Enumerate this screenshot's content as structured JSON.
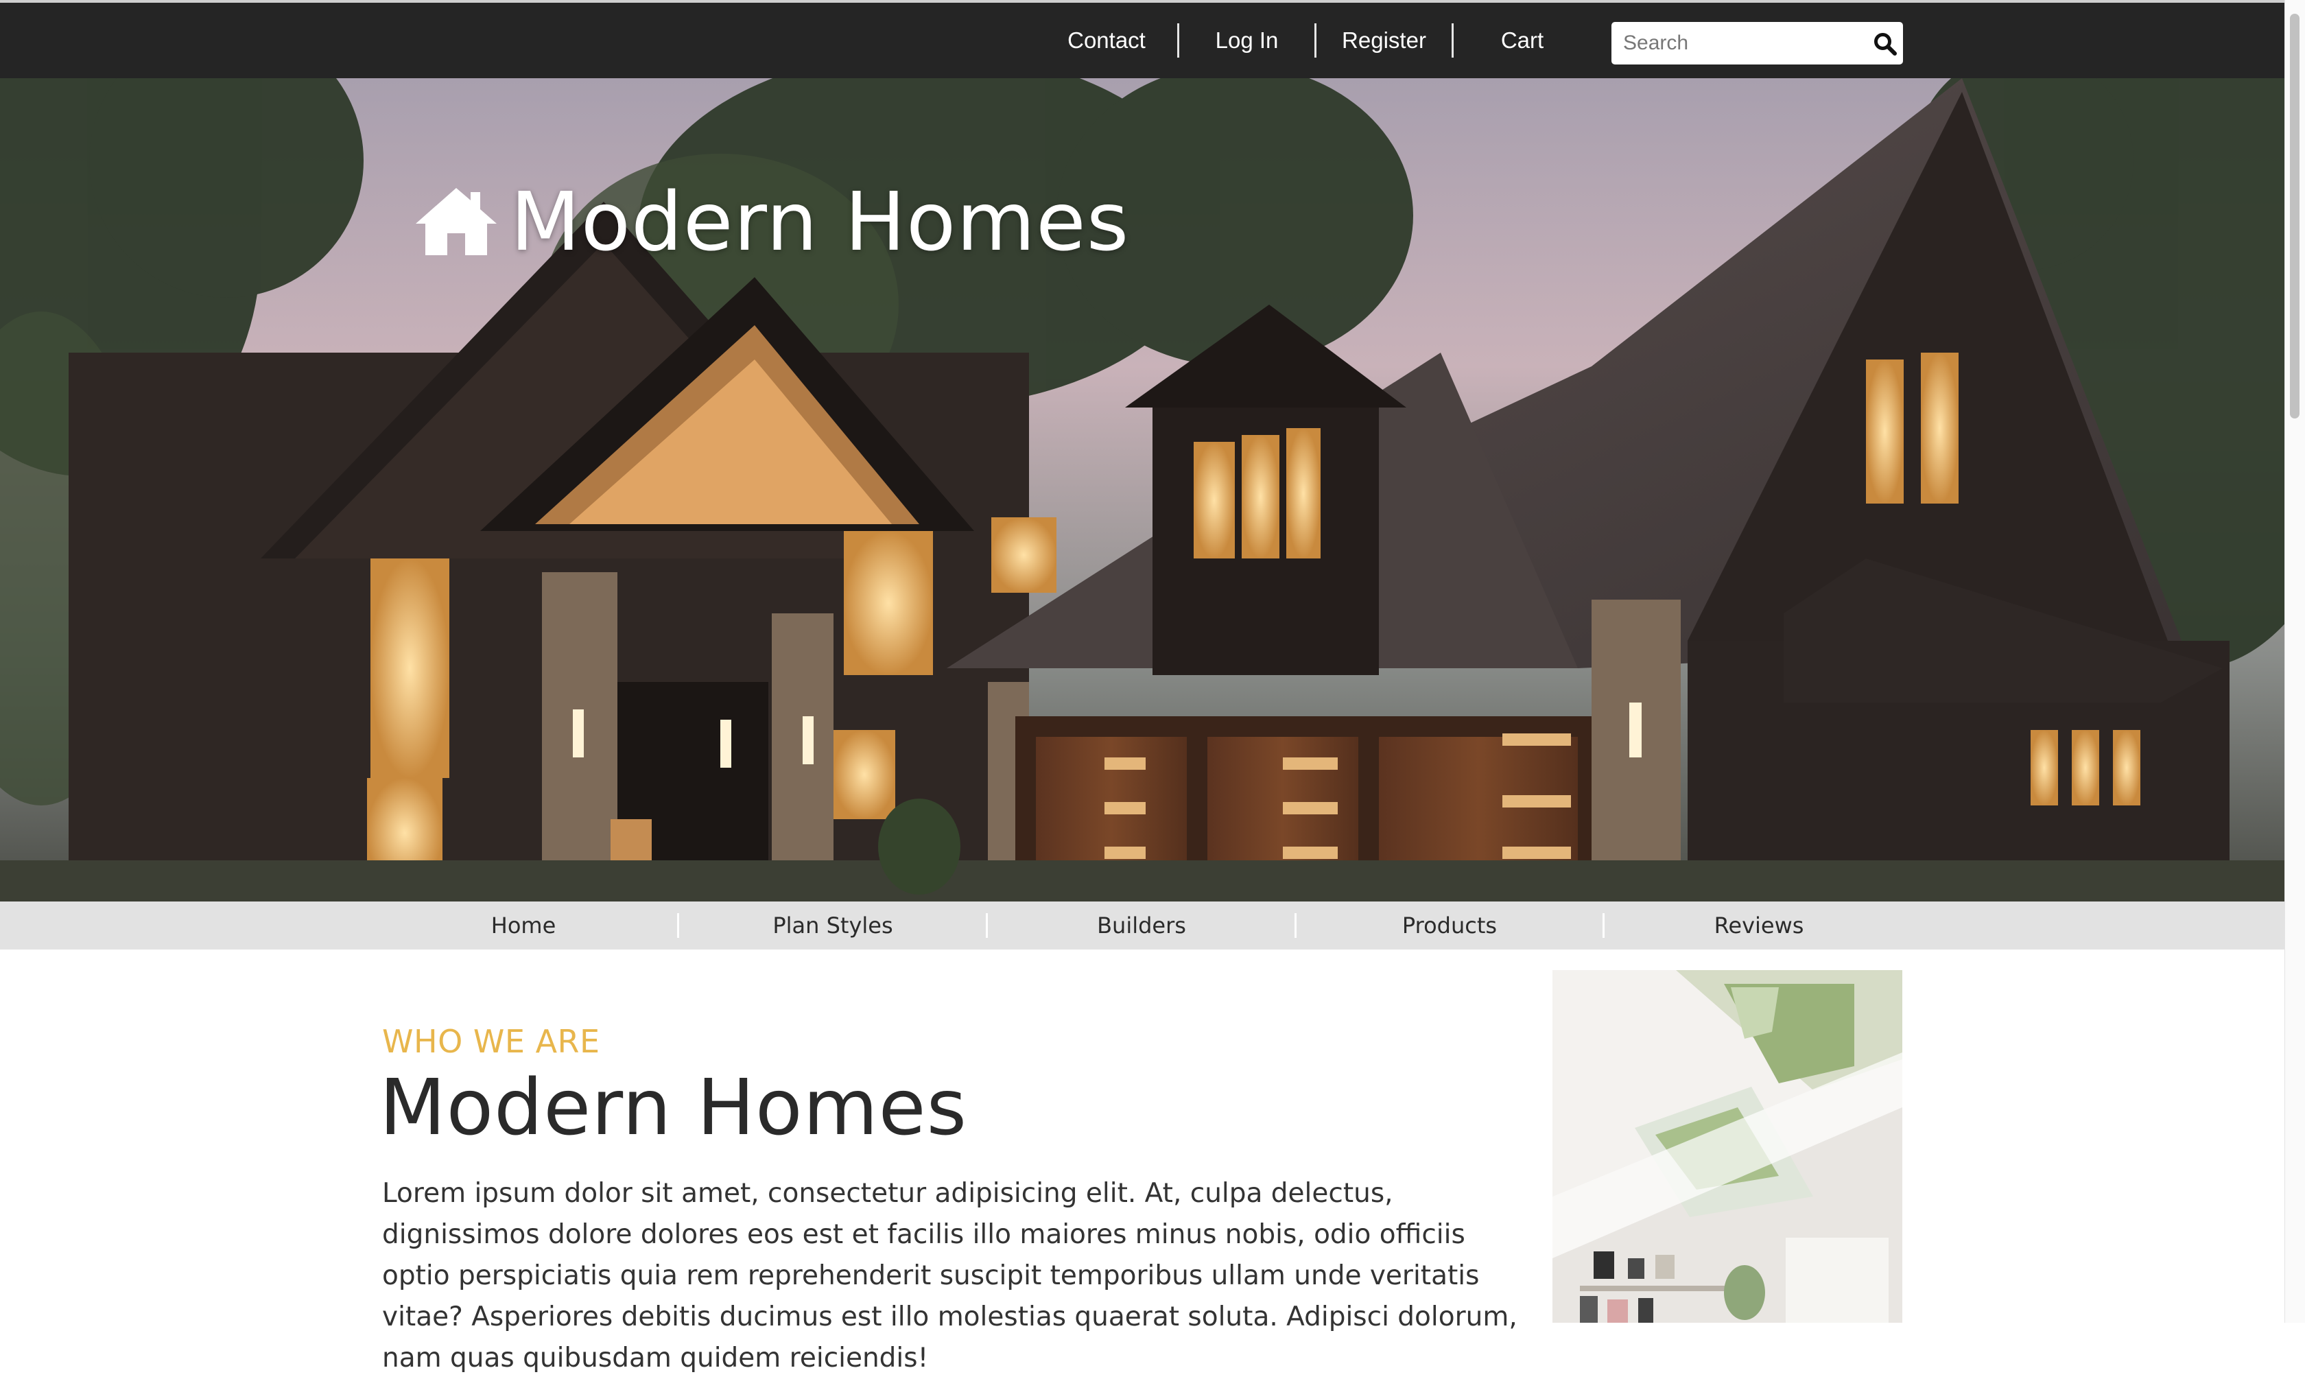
{
  "top_nav": {
    "links": [
      "Contact",
      "Log In",
      "Register",
      "Cart"
    ],
    "search_placeholder": "Search",
    "search_icon": "search-icon"
  },
  "hero": {
    "brand_icon": "home-icon",
    "brand_name": "Modern Homes",
    "image": "photo of a modern dark-sided house at dusk"
  },
  "sub_nav": {
    "items": [
      "Home",
      "Plan Styles",
      "Builders",
      "Products",
      "Reviews"
    ]
  },
  "about": {
    "eyebrow": "WHO WE ARE",
    "title": "Modern Homes",
    "body": "Lorem ipsum dolor sit amet, consectetur adipisicing elit. At, culpa delectus, dignissimos dolore dolores eos est et facilis illo maiores minus nobis, odio officiis optio perspiciatis quia rem reprehenderit suscipit temporibus ullam unde veritatis vitae? Asperiores debitis ducimus est illo molestias quaerat soluta. Adipisci dolorum, nam quas quibusdam quidem reiciendis!"
  },
  "colors": {
    "topbar": "#252525",
    "subnav": "#e2e2e2",
    "accent": "#e8b64c",
    "heading": "#2a2a2a"
  }
}
